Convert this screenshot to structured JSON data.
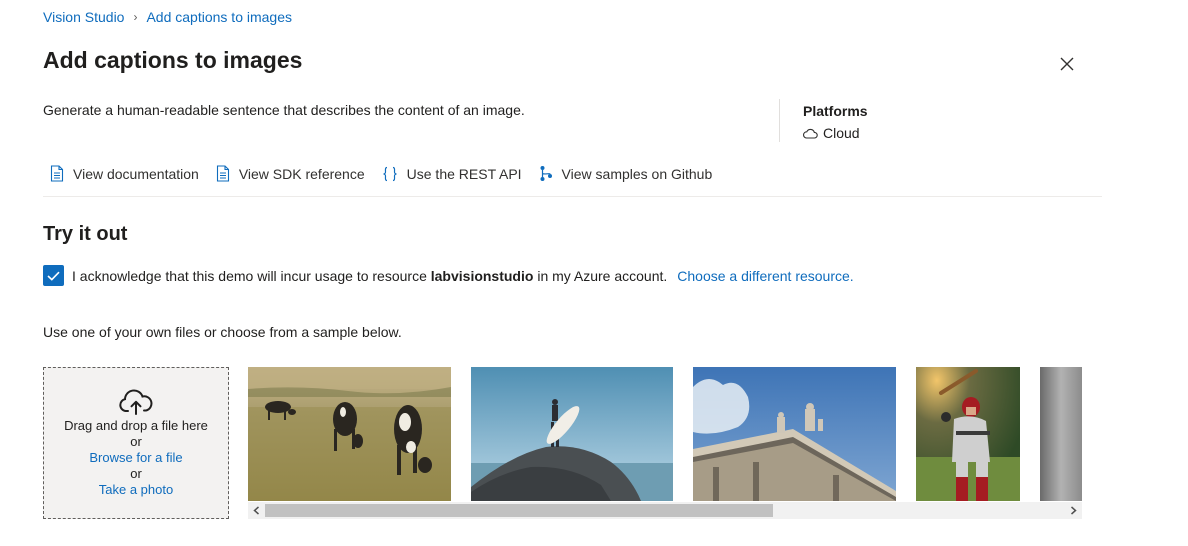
{
  "breadcrumb": {
    "root": "Vision Studio",
    "current": "Add captions to images",
    "separator": "›"
  },
  "page": {
    "title": "Add captions to images",
    "description": "Generate a human-readable sentence that describes the content of an image."
  },
  "platforms": {
    "heading": "Platforms",
    "value": "Cloud",
    "icon": "cloud-icon"
  },
  "links": [
    {
      "label": "View documentation",
      "icon": "document-icon"
    },
    {
      "label": "View SDK reference",
      "icon": "document-icon"
    },
    {
      "label": "Use the REST API",
      "icon": "braces-icon"
    },
    {
      "label": "View samples on Github",
      "icon": "branch-icon"
    }
  ],
  "try_it_out": {
    "title": "Try it out",
    "ack_checked": true,
    "ack_prefix": "I acknowledge that this demo will incur usage to resource ",
    "ack_resource": "labvisionstudio",
    "ack_suffix": " in my Azure account.",
    "change_resource": "Choose a different resource.",
    "instruction": "Use one of your own files or choose from a sample below."
  },
  "upload": {
    "drag_text": "Drag and drop a file here",
    "or1": "or",
    "browse": "Browse for a file",
    "or2": "or",
    "take_photo": "Take a photo",
    "icon": "cloud-upload-icon"
  },
  "samples": [
    "cows-in-field",
    "surfer-on-rock",
    "statue-building",
    "baseball-batter",
    "gray-abstract"
  ],
  "colors": {
    "accent": "#0f6cbd",
    "text": "#201f1e",
    "link": "#0f6cbd"
  }
}
